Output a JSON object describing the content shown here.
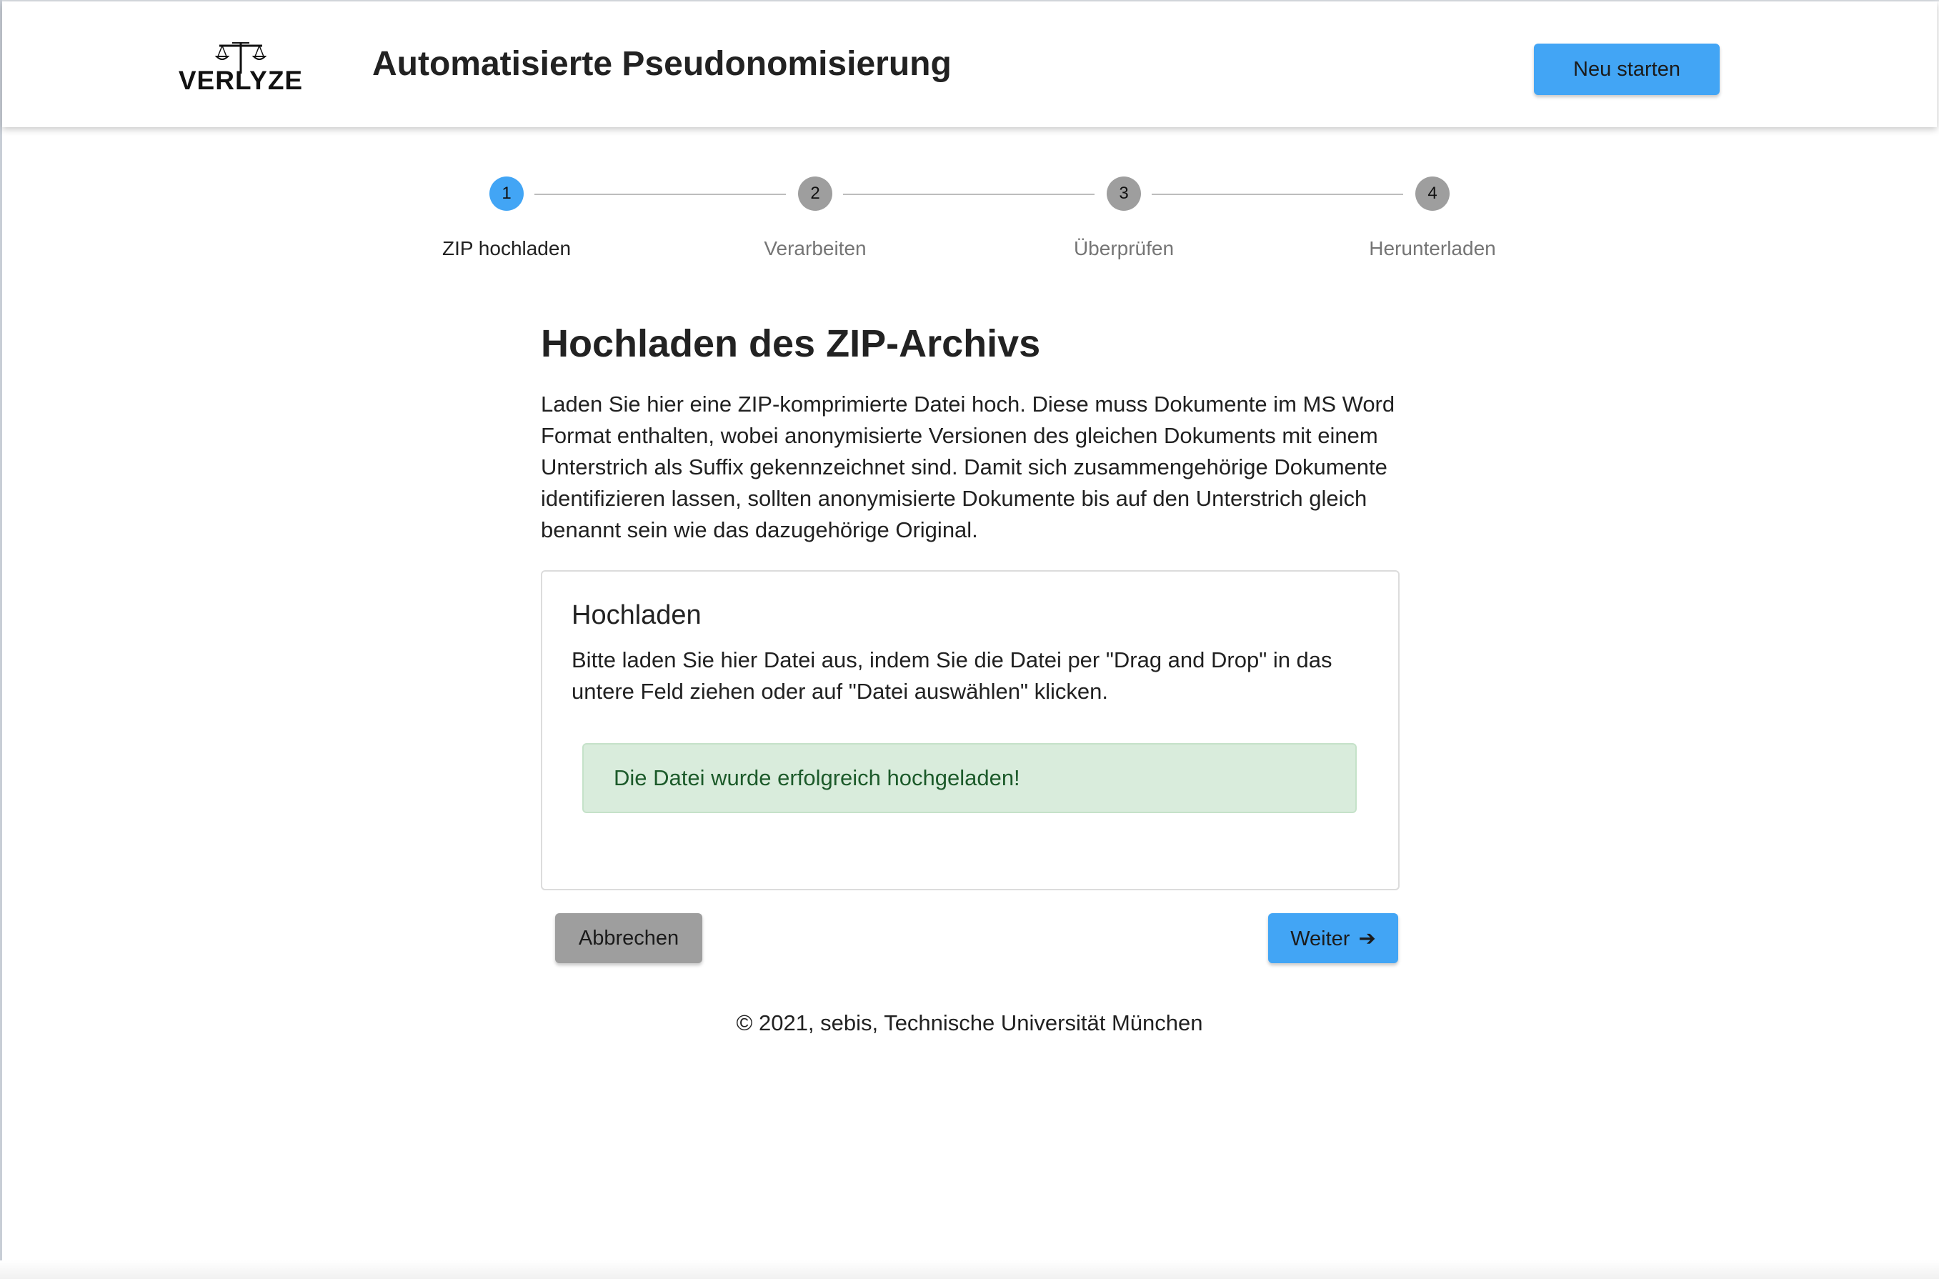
{
  "header": {
    "logo_text": "VERLYZE",
    "title": "Automatisierte Pseudonomisierung",
    "restart_button": "Neu starten"
  },
  "stepper": {
    "active_step": 1,
    "steps": [
      {
        "number": "1",
        "label": "ZIP hochladen"
      },
      {
        "number": "2",
        "label": "Verarbeiten"
      },
      {
        "number": "3",
        "label": "Überprüfen"
      },
      {
        "number": "4",
        "label": "Herunterladen"
      }
    ]
  },
  "main": {
    "heading": "Hochladen des ZIP-Archivs",
    "intro": "Laden Sie hier eine ZIP-komprimierte Datei hoch. Diese muss Dokumente im MS Word Format enthalten, wobei anonymisierte Versionen des gleichen Dokuments mit einem Unterstrich als Suffix gekennzeichnet sind. Damit sich zusammengehörige Dokumente identifizieren lassen, sollten anonymisierte Dokumente bis auf den Unterstrich gleich benannt sein wie das dazugehörige Original."
  },
  "upload_card": {
    "title": "Hochladen",
    "description": "Bitte laden Sie hier Datei aus, indem Sie die Datei per \"Drag and Drop\" in das untere Feld ziehen oder auf \"Datei auswählen\" klicken.",
    "success_message": "Die Datei wurde erfolgreich hochgeladen!"
  },
  "actions": {
    "cancel": "Abbrechen",
    "next": "Weiter",
    "next_icon": "arrow-right-icon"
  },
  "footer": {
    "copyright": "© 2021, sebis, Technische Universität München"
  },
  "colors": {
    "primary": "#42a5f5",
    "secondary": "#9e9e9e",
    "success_bg": "#d9ecdc",
    "success_text": "#1c5a2a"
  }
}
